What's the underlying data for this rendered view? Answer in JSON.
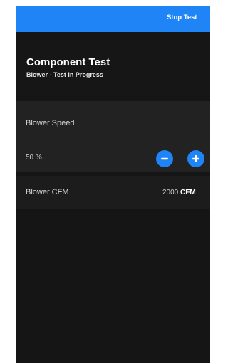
{
  "topbar": {
    "stop_label": "Stop Test"
  },
  "header": {
    "title": "Component Test",
    "subtitle": "Blower - Test in Progress"
  },
  "blower_speed": {
    "label": "Blower Speed",
    "value": "50 %",
    "decrease_icon": "minus-icon",
    "increase_icon": "plus-icon"
  },
  "blower_cfm": {
    "label": "Blower CFM",
    "value": "2000",
    "unit": "CFM"
  },
  "colors": {
    "accent": "#1f84f5",
    "background": "#151515",
    "card": "#222222"
  }
}
